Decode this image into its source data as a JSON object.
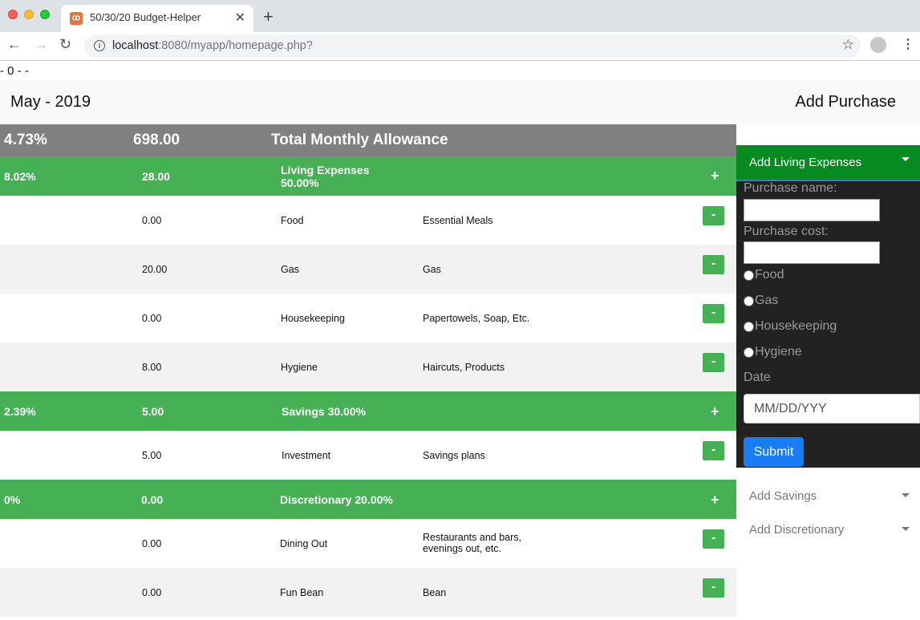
{
  "browser": {
    "tab_title": "50/30/20 Budget-Helper",
    "url_host": "localhost",
    "url_rest": ":8080/myapp/homepage.php?"
  },
  "debug_text": "- 0 - -",
  "header": {
    "month": "May - 2019",
    "add_purchase": "Add Purchase"
  },
  "total": {
    "percent": "4.73%",
    "amount": "698.00",
    "label": "Total Monthly Allowance"
  },
  "categories": [
    {
      "percent": "8.02%",
      "amount": "28.00",
      "label": "Living Expenses",
      "share": "50.00%",
      "items": [
        {
          "value": "0.00",
          "name": "Food",
          "desc": "Essential Meals"
        },
        {
          "value": "20.00",
          "name": "Gas",
          "desc": "Gas"
        },
        {
          "value": "0.00",
          "name": "Housekeeping",
          "desc": "Papertowels, Soap, Etc."
        },
        {
          "value": "8.00",
          "name": "Hygiene",
          "desc": "Haircuts, Products"
        }
      ]
    },
    {
      "percent": "2.39%",
      "amount": "5.00",
      "label": "Savings 30.00%",
      "items": [
        {
          "value": "5.00",
          "name": "Investment",
          "desc": "Savings plans"
        }
      ]
    },
    {
      "percent": "0%",
      "amount": "0.00",
      "label": "Discretionary 20.00%",
      "items": [
        {
          "value": "0.00",
          "name": "Dining Out",
          "desc_line1": "Restaurants and bars,",
          "desc_line2": "evenings out, etc."
        },
        {
          "value": "0.00",
          "name": "Fun Bean",
          "desc": "Bean"
        }
      ]
    }
  ],
  "buttons": {
    "plus": "+",
    "minus": "-"
  },
  "sidebar": {
    "living_header": "Add Living Expenses",
    "purchase_name_label": "Purchase name:",
    "purchase_cost_label": "Purchase cost:",
    "radio_options": [
      "Food",
      "Gas",
      "Housekeeping",
      "Hygiene"
    ],
    "date_label": "Date",
    "date_placeholder": "MM/DD/YYY",
    "submit_label": "Submit",
    "savings_header": "Add Savings",
    "discretionary_header": "Add Discretionary"
  }
}
